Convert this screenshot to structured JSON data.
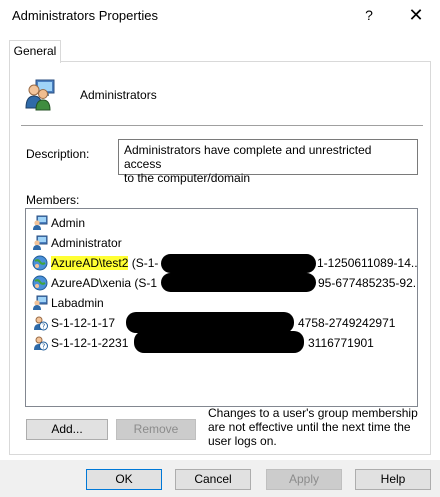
{
  "window": {
    "title": "Administrators Properties",
    "help_glyph": "?",
    "close_glyph": "✕"
  },
  "tabs": [
    {
      "label": "General",
      "selected": true
    }
  ],
  "group": {
    "icon": "group-users-icon",
    "name": "Administrators"
  },
  "description": {
    "label": "Description:",
    "value": "Administrators have complete and unrestricted access\nto the computer/domain"
  },
  "members": {
    "label": "Members:",
    "items": [
      {
        "icon": "user-icon",
        "name": "Admin"
      },
      {
        "icon": "user-icon",
        "name": "Administrator"
      },
      {
        "icon": "azure-user-icon",
        "name": "AzureAD\\test2",
        "name_suffix": " (S-1-",
        "tail": "1-1250611089-14...",
        "highlighted": true
      },
      {
        "icon": "azure-user-icon",
        "name": "AzureAD\\xenia (S-1",
        "tail": "95-677485235-92..."
      },
      {
        "icon": "user-icon",
        "name": "Labadmin"
      },
      {
        "icon": "unknown-sid-icon",
        "name": "S-1-12-1-17",
        "tail": "4758-2749242971"
      },
      {
        "icon": "unknown-sid-icon",
        "name": "S-1-12-1-2231",
        "tail": "3116771901"
      }
    ]
  },
  "buttons": {
    "add": "Add...",
    "remove": "Remove",
    "ok": "OK",
    "cancel": "Cancel",
    "apply": "Apply",
    "help": "Help"
  },
  "membership_note": "Changes to a user's group membership are not effective until the next time the user logs on.",
  "colors": {
    "highlight": "#ffff33",
    "default_button_border": "#0078d7",
    "redaction": "#000000"
  }
}
